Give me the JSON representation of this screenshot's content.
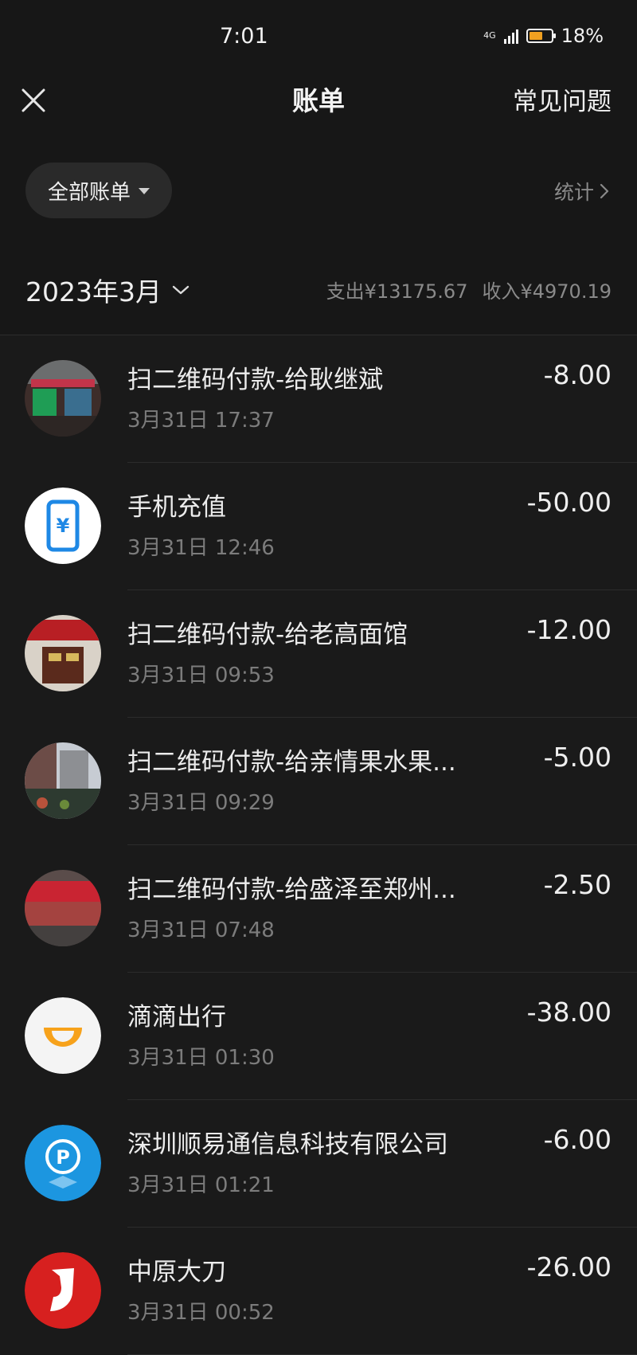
{
  "status": {
    "time": "7:01",
    "network": "4G",
    "battery": "18%",
    "battery_level": 0.18,
    "battery_color": "#f0a020"
  },
  "nav": {
    "close_icon": "close-icon",
    "title": "账单",
    "faq": "常见问题"
  },
  "filter": {
    "label": "全部账单",
    "stats": "统计"
  },
  "month": {
    "label": "2023年3月",
    "expense": "支出¥13175.67",
    "income": "收入¥4970.19"
  },
  "transactions": [
    {
      "title": "扫二维码付款-给耿继斌",
      "time": "3月31日 17:37",
      "amount": "-8.00",
      "icon": "storefront-photo"
    },
    {
      "title": "手机充值",
      "time": "3月31日 12:46",
      "amount": "-50.00",
      "icon": "phone-recharge-icon"
    },
    {
      "title": "扫二维码付款-给老高面馆",
      "time": "3月31日 09:53",
      "amount": "-12.00",
      "icon": "noodle-shop-photo"
    },
    {
      "title": "扫二维码付款-给亲情果水果...",
      "time": "3月31日 09:29",
      "amount": "-5.00",
      "icon": "fruit-shop-photo"
    },
    {
      "title": "扫二维码付款-给盛泽至郑州...",
      "time": "3月31日 07:48",
      "amount": "-2.50",
      "icon": "restaurant-photo"
    },
    {
      "title": "滴滴出行",
      "time": "3月31日 01:30",
      "amount": "-38.00",
      "icon": "didi-logo"
    },
    {
      "title": "深圳顺易通信息科技有限公司",
      "time": "3月31日 01:21",
      "amount": "-6.00",
      "icon": "parking-logo"
    },
    {
      "title": "中原大刀",
      "time": "3月31日 00:52",
      "amount": "-26.00",
      "icon": "red-brand-logo"
    }
  ]
}
